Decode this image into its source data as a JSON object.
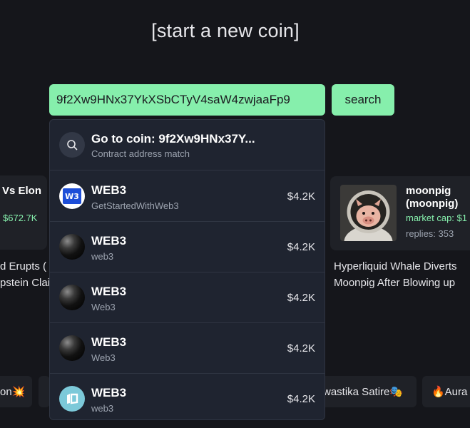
{
  "header": {
    "title": "[start a new coin]"
  },
  "search": {
    "value": "9f2Xw9HNx37YkXSbCTyV4saW4zwjaaFp9",
    "button_label": "search"
  },
  "background": {
    "left_card": {
      "name": "Vs Elon",
      "market_cap": "$672.7K",
      "headline_line1": "d Erupts (",
      "headline_line2": "pstein Clai"
    },
    "right_card": {
      "name": "moonpig (moonpig)",
      "market_cap": "market cap: $1",
      "replies": "replies: 353",
      "headline_line1": "Hyperliquid Whale Diverts",
      "headline_line2": "Moonpig After Blowing up"
    },
    "chips": [
      {
        "label": "on💥"
      },
      {
        "label": ""
      },
      {
        "label": "wastika Satire🎭"
      },
      {
        "label": "🔥Aura"
      }
    ]
  },
  "dropdown": {
    "goto": {
      "title": "Go to coin: 9f2Xw9HNx37Y...",
      "subtitle": "Contract address match",
      "icon": "search-icon"
    },
    "results": [
      {
        "name": "WEB3",
        "subtitle": "GetStartedWithWeb3",
        "price": "$4.2K",
        "icon": "web3-logo-icon",
        "icon_text": "W3"
      },
      {
        "name": "WEB3",
        "subtitle": "web3",
        "price": "$4.2K",
        "icon": "black-orb-icon"
      },
      {
        "name": "WEB3",
        "subtitle": "Web3",
        "price": "$4.2K",
        "icon": "black-orb-icon"
      },
      {
        "name": "WEB3",
        "subtitle": "Web3",
        "price": "$4.2K",
        "icon": "black-orb-icon"
      },
      {
        "name": "WEB3",
        "subtitle": "web3",
        "price": "$4.2K",
        "icon": "teal-logo-icon"
      }
    ]
  },
  "colors": {
    "background": "#15161b",
    "accent_green": "#86efac",
    "dropdown_bg": "#1f2430",
    "muted_text": "#9ca3af"
  }
}
